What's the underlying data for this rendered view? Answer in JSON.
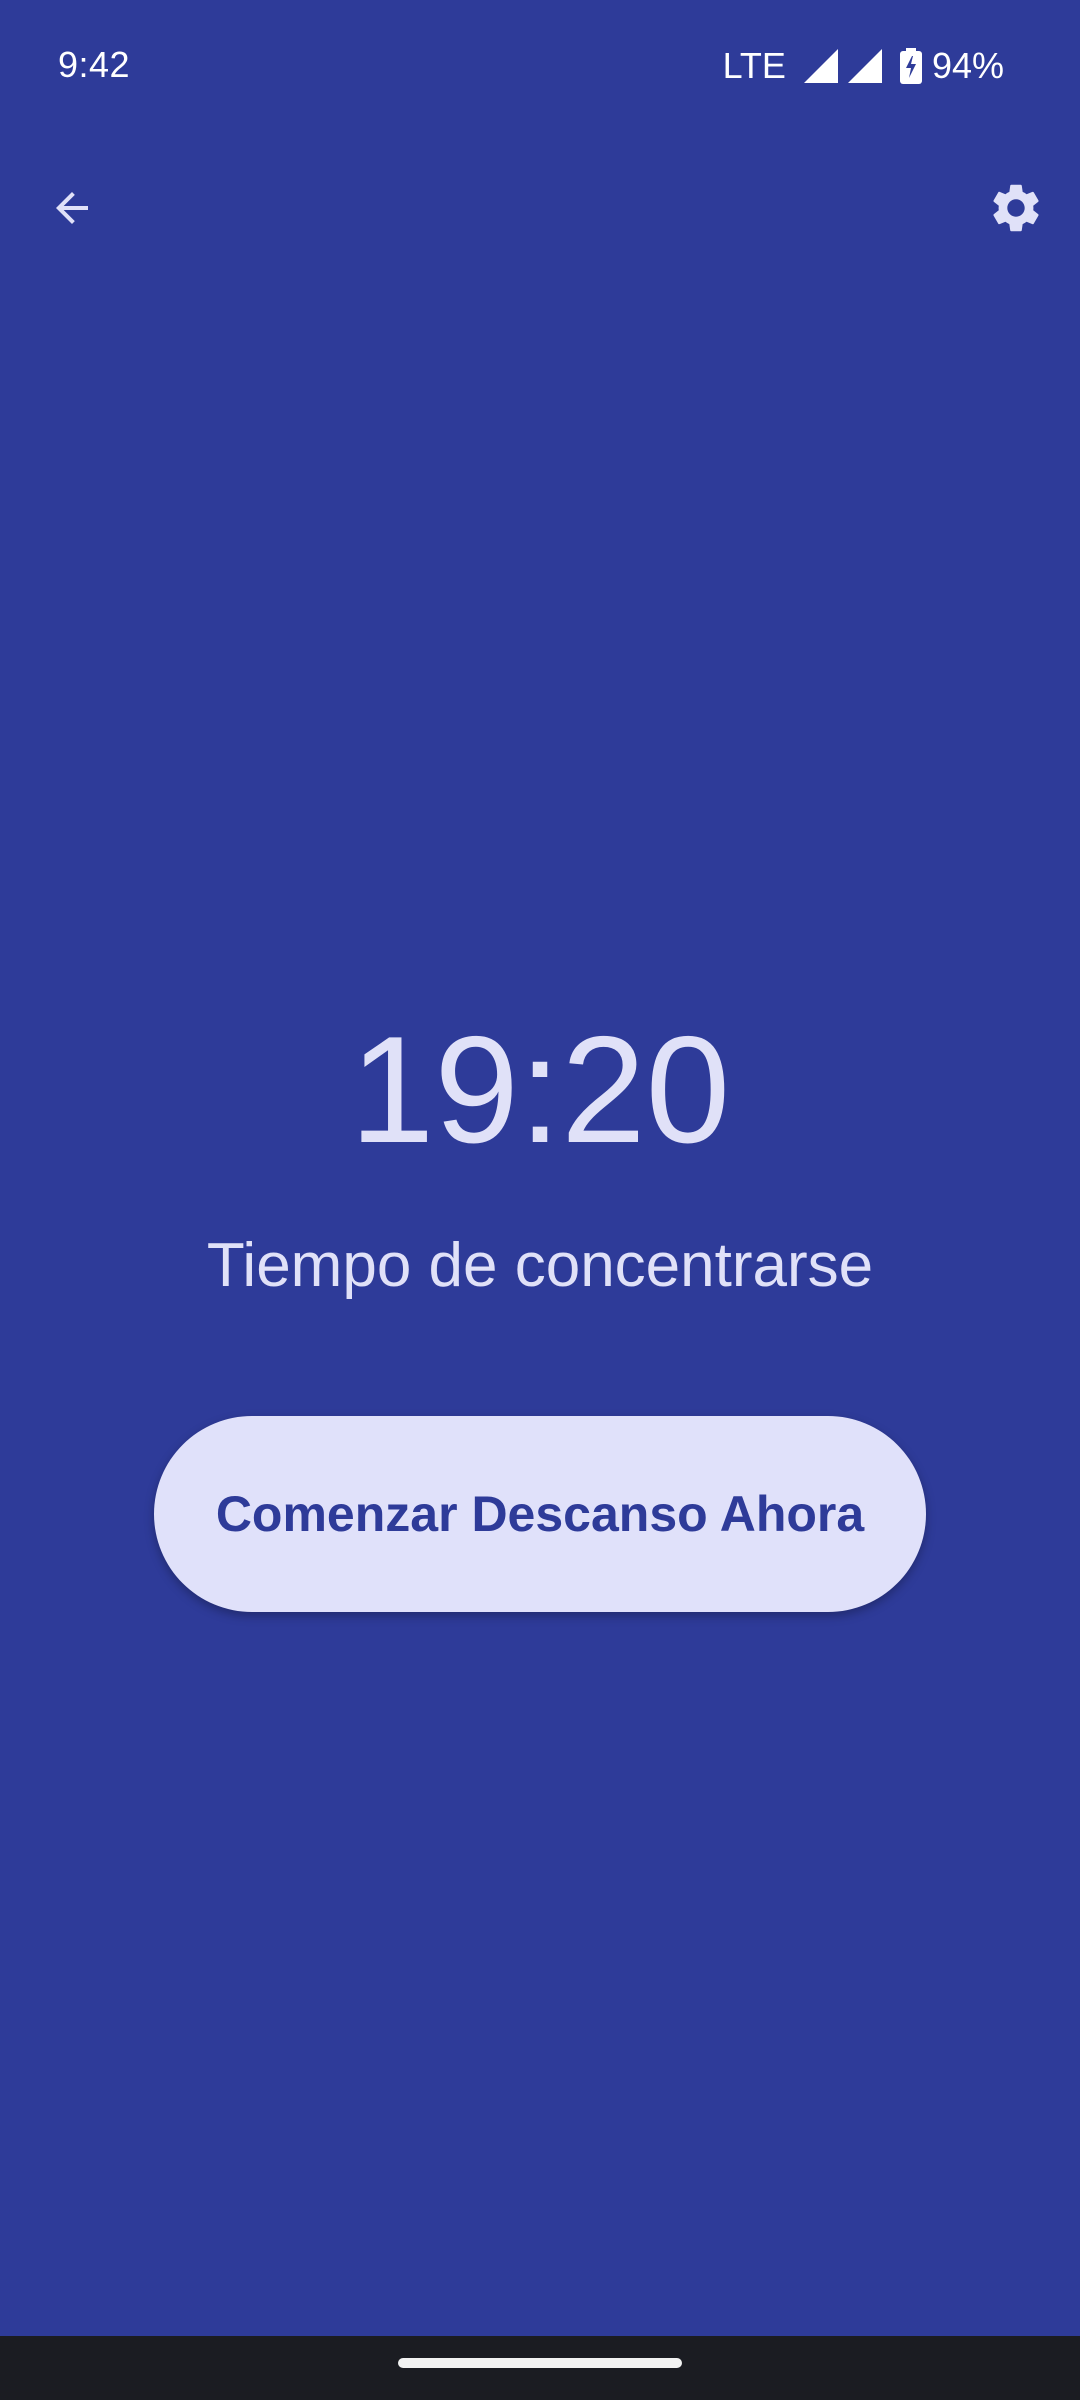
{
  "status_bar": {
    "time": "9:42",
    "network": "LTE",
    "battery": "94%"
  },
  "toolbar": {
    "back_icon": "arrow-back-icon",
    "settings_icon": "gear-icon"
  },
  "timer": {
    "value": "19:20",
    "label": "Tiempo de concentrarse"
  },
  "actions": {
    "start_break_label": "Comenzar Descanso Ahora"
  },
  "colors": {
    "background": "#2e3b99",
    "button_bg": "#e0e1fa",
    "text": "#e0e1f8"
  }
}
